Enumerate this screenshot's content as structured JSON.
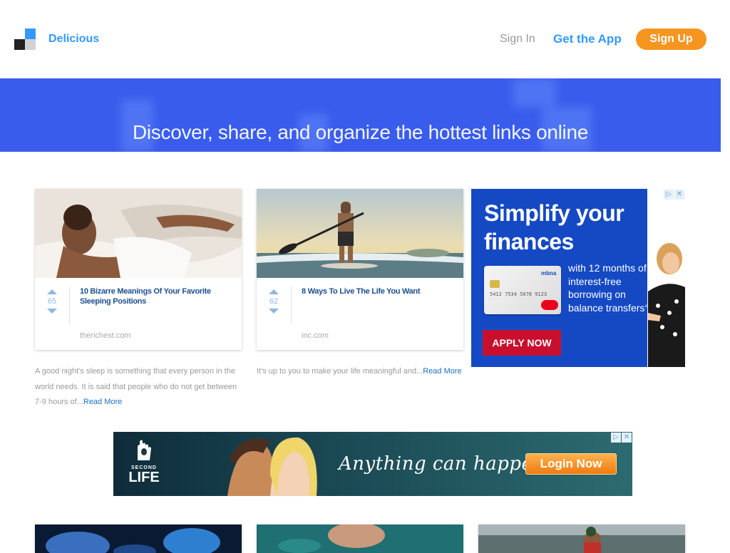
{
  "header": {
    "brand": "Delicious",
    "sign_in": "Sign In",
    "get_app": "Get the App",
    "sign_up": "Sign Up"
  },
  "hero": {
    "tagline": "Discover, share, and organize the hottest links online"
  },
  "cards": [
    {
      "votes": "65",
      "title": "10 Bizarre Meanings Of Your Favorite Sleeping Positions",
      "domain": "therichest.com",
      "description": "A good night's sleep is something that every person in the world needs. It is said that people who do not get between 7-9 hours of...",
      "read_more": "Read More"
    },
    {
      "votes": "62",
      "title": "8 Ways To Live The Life You Want",
      "domain": "inc.com",
      "description": "It's up to you to make your life meaningful and...",
      "read_more": "Read More"
    }
  ],
  "ad_side": {
    "headline": "Simplify your finances",
    "sub": "with 12 months of interest-free borrowing on balance transfers°",
    "cta": "APPLY NOW",
    "card_brand": "mbna",
    "card_number": "5412 7534 5678 9123",
    "adchoice": [
      "▷",
      "✕"
    ]
  },
  "ad_banner": {
    "logo_line1": "SECOND",
    "logo_line2": "LIFE",
    "slogan": "Anything can happen...",
    "cta": "Login Now",
    "adchoice": [
      "▷",
      "✕"
    ]
  },
  "colors": {
    "accent": "#3399ff",
    "signup": "#f6951f",
    "hero": "#3a5ced",
    "link": "#1a6fc4"
  }
}
